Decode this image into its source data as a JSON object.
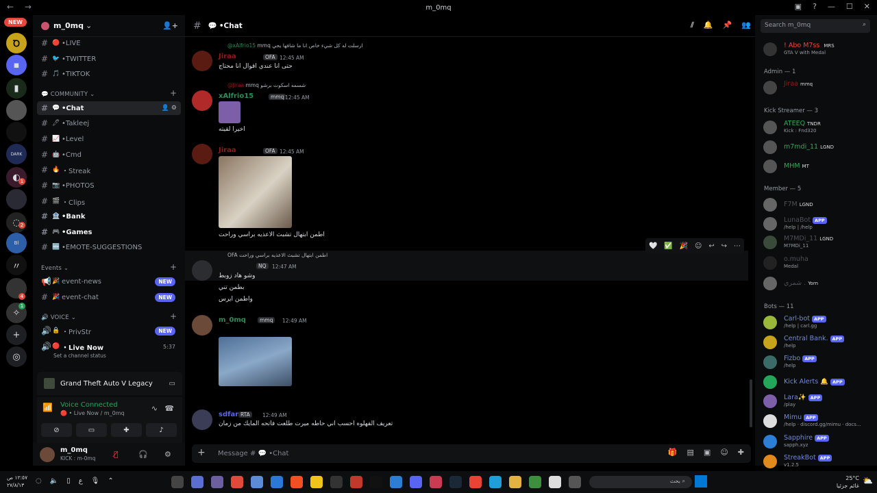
{
  "window": {
    "title": "m_0mq"
  },
  "rail": {
    "new_badge": "NEW",
    "mentions": [
      "1",
      "2",
      "4",
      "1"
    ]
  },
  "server": {
    "name": "m_0mq"
  },
  "channels_top": [
    {
      "emoji": "🔴",
      "name": "•LIVE"
    },
    {
      "emoji": "🐦",
      "name": "•TWITTER"
    },
    {
      "emoji": "🎵",
      "name": "•TIKTOK"
    }
  ],
  "community": {
    "label": "COMMUNITY",
    "channels": [
      {
        "emoji": "💬",
        "name": "•Chat",
        "active": true
      },
      {
        "emoji": "🖊",
        "name": "•Takleej"
      },
      {
        "emoji": "📈",
        "name": "•Level"
      },
      {
        "emoji": "🤖",
        "name": "•Cmd"
      },
      {
        "emoji": "🔥",
        "name": "・Streak"
      },
      {
        "emoji": "📷",
        "name": "•PHOTOS"
      },
      {
        "emoji": "🎬",
        "name": "・Clips"
      },
      {
        "emoji": "🏦",
        "name": "•Bank",
        "bold": true
      },
      {
        "emoji": "🎮",
        "name": "•Games",
        "bold": true
      },
      {
        "emoji": "🆕",
        "name": "•EMOTE-SUGGESTIONS"
      }
    ]
  },
  "events": {
    "label": "Events",
    "channels": [
      {
        "emoji": "🎉",
        "name": "event-news",
        "badge": "NEW"
      },
      {
        "emoji": "🎉",
        "name": "event-chat",
        "badge": "NEW"
      }
    ]
  },
  "voice_cat": {
    "label": "VOICE",
    "channels": [
      {
        "emoji": "🔒",
        "name": "・PrivStr",
        "badge": "NEW"
      },
      {
        "emoji": "🔴",
        "name": "・Live Now",
        "timer": "5:37",
        "status": "Set a channel status"
      }
    ]
  },
  "activity": {
    "game": "Grand Theft Auto V Legacy"
  },
  "voice_panel": {
    "status": "Voice Connected",
    "location": "🔴 • Live Now / m_0mq"
  },
  "user": {
    "name": "m_0mq",
    "status": "KICK : m-0mq"
  },
  "channel": {
    "name": "•Chat",
    "composer_placeholder": "Message # 💬 •Chat"
  },
  "messages": [
    {
      "reply": "ارسلت له كل شيء خاص انا ما شافها يحي",
      "reply_user": "@xAlfrio15",
      "reply_tag": "mmq",
      "name": "Jiraa",
      "tag": "OFA",
      "time": "12:45 AM",
      "text": "حتى انا عندي اقوال انا محتاج"
    },
    {
      "reply": "شسمه اسكوت برشو",
      "reply_user": "@Jiraa",
      "reply_tag": "mmq",
      "name": "xAlfrio15",
      "tag": "mmq",
      "time": "12:45 AM",
      "text": "اخيرا لقيته"
    },
    {
      "name": "Jiraa",
      "tag": "OFA",
      "time": "12:45 AM",
      "text": "اطمن ابتهال تشبث الاعذيه براسي وراحت"
    },
    {
      "reply": "اطمن ابتهال تشبث الاعذيه براسي وراحت",
      "reply_tag": "OFA",
      "name": "",
      "tag": "NQ",
      "time": "12:47 AM",
      "lines": [
        "وشو هاد زوبط",
        "بطمن تني",
        "واطمن ايرس"
      ]
    },
    {
      "name": "m_0mq",
      "tag": "mmq",
      "time": "12:49 AM"
    },
    {
      "name": "sdfar",
      "tag": "RTA",
      "time": "12:49 AM",
      "text": "تعريف الفهلوه احسب اني حاطه ميرت طلعت فاتحه المايك من زمان"
    }
  ],
  "members": {
    "search_placeholder": "Search m_0mq",
    "top": {
      "name": "! Abo M7ss",
      "tag": "MRS",
      "status": "GTA V with Medal"
    },
    "groups": [
      {
        "label": "Admin — 1",
        "items": [
          {
            "name": "Jiraa",
            "tag": "mmq",
            "status": "",
            "color": "#8e1d1d"
          }
        ]
      },
      {
        "label": "Kick Streamer — 3",
        "items": [
          {
            "name": "ATEEQ",
            "tag": "TNDR",
            "status": "Kick : Fnd320",
            "color": "#3ba55d"
          },
          {
            "name": "m7mdi_11",
            "tag": "LGND",
            "status": "",
            "color": "#3ba55d"
          },
          {
            "name": "MHM",
            "tag": "MT",
            "status": "",
            "color": "#3ba55d"
          }
        ]
      },
      {
        "label": "Member — 5",
        "items": [
          {
            "name": "F7M",
            "tag": "LGND",
            "status": "",
            "color": "#4e5058"
          },
          {
            "name": "LunaBot",
            "tag": "APP",
            "status": "/help | /help",
            "color": "#4e5058"
          },
          {
            "name": "M7MDi_11",
            "tag": "LGND",
            "status": "M7MDi_11",
            "color": "#4e5058"
          },
          {
            "name": "o.muha",
            "tag": "",
            "status": "Medal",
            "color": "#4e5058"
          },
          {
            "name": "شمري .",
            "tag": "Yorn",
            "status": "",
            "color": "#4e5058"
          }
        ]
      },
      {
        "label": "Bots — 11",
        "items": [
          {
            "name": "Carl-bot",
            "tag": "APP",
            "status": "/help | carl.gg",
            "color": "#7289da"
          },
          {
            "name": "Central Bank.",
            "tag": "APP",
            "status": "/help",
            "color": "#7289da"
          },
          {
            "name": "Fizbo",
            "tag": "APP",
            "status": "/help",
            "color": "#7289da"
          },
          {
            "name": "Kick Alerts 🔔",
            "tag": "APP",
            "status": "",
            "color": "#7289da"
          },
          {
            "name": "Lara✨",
            "tag": "APP",
            "status": "/play",
            "color": "#7289da"
          },
          {
            "name": "Mimu",
            "tag": "APP",
            "status": "/help · discord.gg/mimu · docs...",
            "color": "#7289da"
          },
          {
            "name": "Sapphire",
            "tag": "APP",
            "status": "sapph.xyz",
            "color": "#7289da"
          },
          {
            "name": "StreakBot",
            "tag": "APP",
            "status": "v1.2.5",
            "color": "#7289da"
          }
        ]
      }
    ]
  },
  "taskbar": {
    "search": "بحث",
    "time": "١٢:٥٧ ص",
    "date": "٢٧/٨/١٣",
    "temp": "25°C",
    "weather": "غائم جزئيا"
  }
}
